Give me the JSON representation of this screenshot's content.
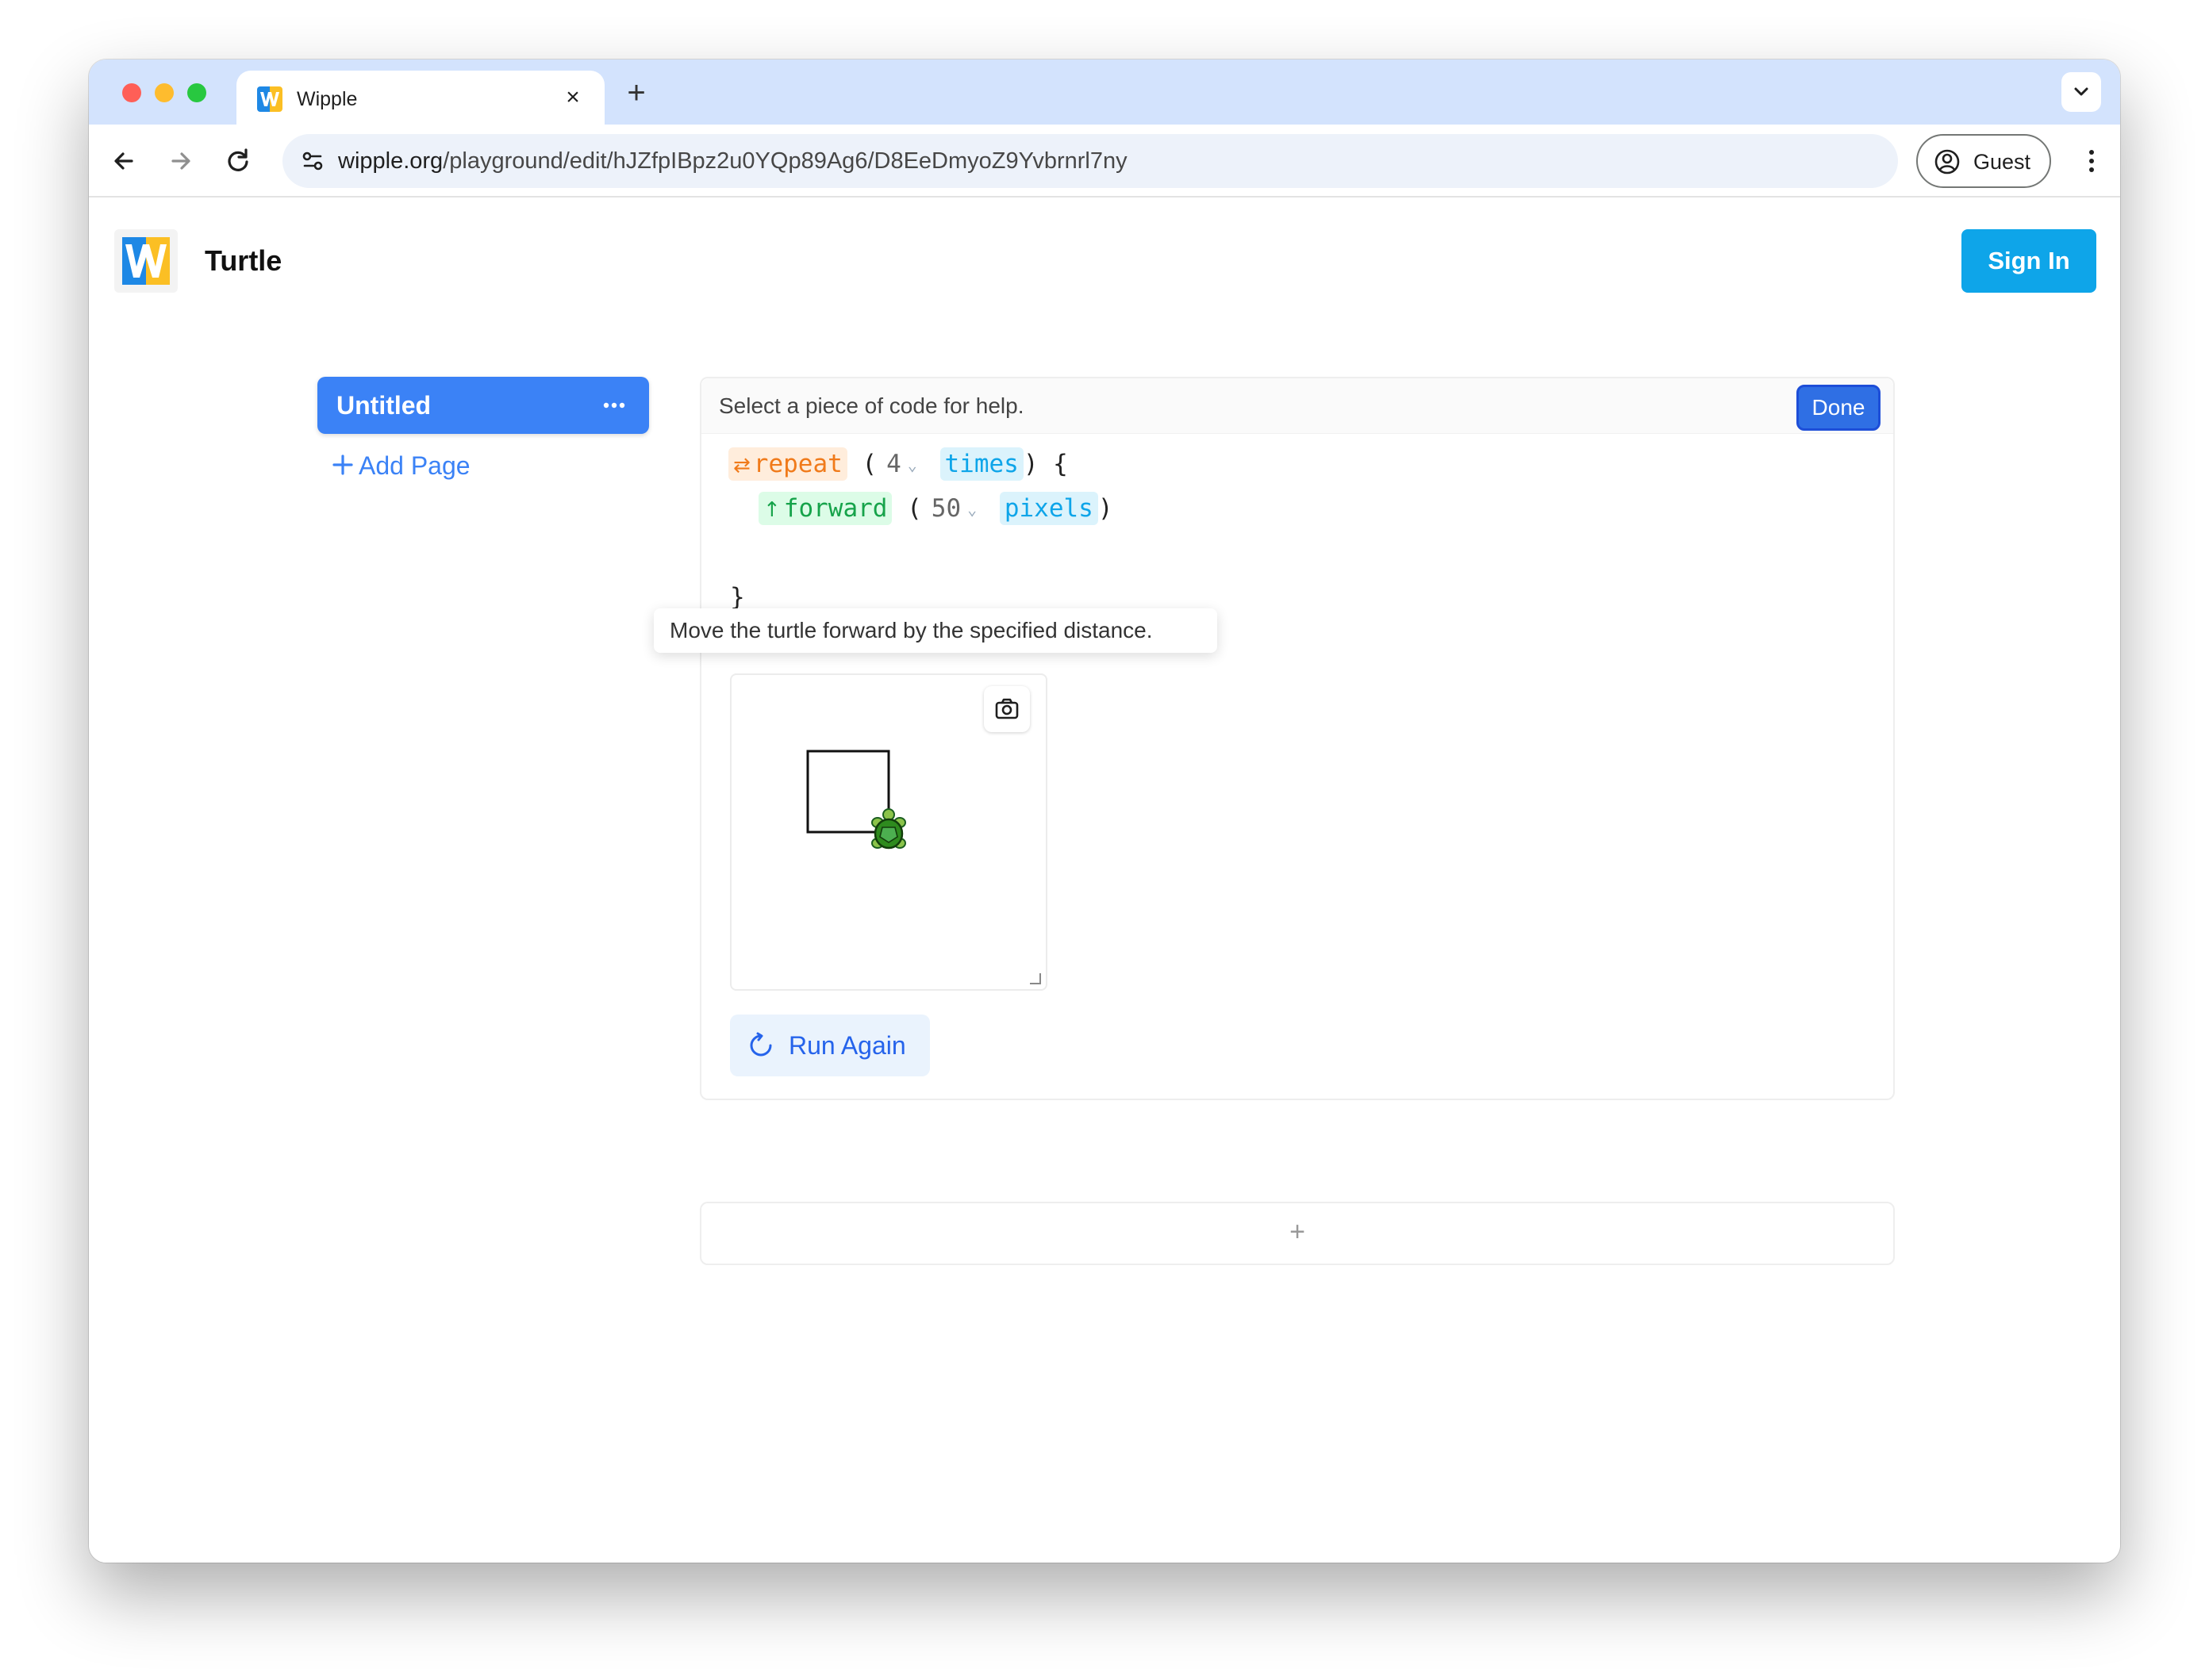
{
  "browser": {
    "tab_title": "Wipple",
    "tab_close": "×",
    "new_tab": "+",
    "url_host": "wipple.org",
    "url_path": "/playground/edit/hJZfpIBpz2u0YQp89Ag6/D8EeDmyoZ9Yvbrnrl7ny",
    "profile_label": "Guest"
  },
  "header": {
    "title": "Turtle",
    "sign_in_label": "Sign In"
  },
  "sidebar": {
    "pages": [
      {
        "label": "Untitled",
        "selected": true
      }
    ],
    "add_page_label": "Add Page"
  },
  "editor": {
    "help_text": "Select a piece of code for help.",
    "done_label": "Done",
    "code": {
      "repeat_kw": "repeat",
      "repeat_count": "4",
      "repeat_unit": "times",
      "open_paren": "(",
      "close_paren_brace": ") {",
      "forward_kw": "forward",
      "forward_open": "(",
      "forward_amount": "50",
      "forward_unit": "pixels",
      "forward_close": ")",
      "close_brace": "}"
    },
    "tooltip": "Move the turtle forward by the specified distance.",
    "run_again_label": "Run Again",
    "add_cell_label": "+"
  },
  "colors": {
    "accent": "#3b82f6",
    "sign_in": "#0ea5e9",
    "repeat": "#f07a1a",
    "forward": "#16a34a",
    "unit": "#0ea5e9",
    "turtle": "#2e8b1e"
  },
  "icons": {
    "back": "arrow-left-icon",
    "forward": "arrow-right-icon",
    "reload": "reload-icon",
    "site_info": "tune-icon",
    "profile": "account-circle-icon",
    "menu": "more-vert-icon",
    "camera": "camera-icon",
    "run_again": "refresh-icon",
    "page_menu": "more-horiz-icon"
  }
}
